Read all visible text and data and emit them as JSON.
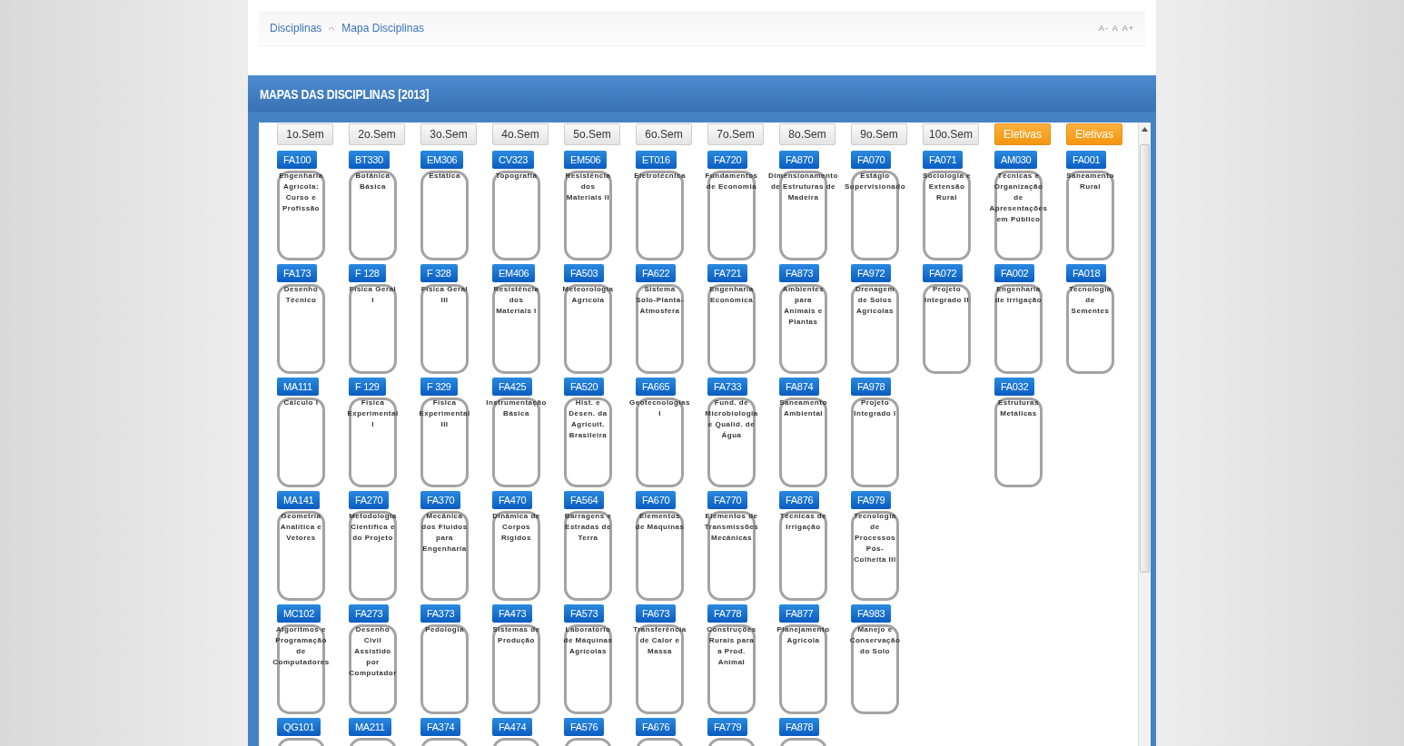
{
  "breadcrumb": [
    {
      "label": "Disciplinas"
    },
    {
      "label": "Mapa Disciplinas"
    }
  ],
  "font_controls": [
    "A-",
    "A",
    "A+"
  ],
  "panel": {
    "title": "MAPAS DAS DISCIPLINAS [2013]"
  },
  "columns": [
    {
      "header": "1o.Sem",
      "kind": "semester",
      "courses": [
        {
          "code": "FA100",
          "name": "Engenharia Agrícola: Curso e Profissão"
        },
        {
          "code": "FA173",
          "name": "Desenho Técnico"
        },
        {
          "code": "MA111",
          "name": "Cálculo I"
        },
        {
          "code": "MA141",
          "name": "Geometria Analítica e Vetores"
        },
        {
          "code": "MC102",
          "name": "Algoritmos e Programação de Computadores"
        },
        {
          "code": "QG101"
        }
      ]
    },
    {
      "header": "2o.Sem",
      "kind": "semester",
      "courses": [
        {
          "code": "BT330",
          "name": "Botânica Básica"
        },
        {
          "code": "F 128",
          "name": "Física Geral I"
        },
        {
          "code": "F 129",
          "name": "Física Experimental I"
        },
        {
          "code": "FA270",
          "name": "Metodologia Científica e do Projeto"
        },
        {
          "code": "FA273",
          "name": "Desenho Civil Assistido por Computador"
        },
        {
          "code": "MA211"
        }
      ]
    },
    {
      "header": "3o.Sem",
      "kind": "semester",
      "courses": [
        {
          "code": "EM306",
          "name": "Estática"
        },
        {
          "code": "F 328",
          "name": "Física Geral III"
        },
        {
          "code": "F 329",
          "name": "Física Experimental III"
        },
        {
          "code": "FA370",
          "name": "Mecânica dos Fluidos para Engenharia"
        },
        {
          "code": "FA373",
          "name": "Pedologia"
        },
        {
          "code": "FA374"
        }
      ]
    },
    {
      "header": "4o.Sem",
      "kind": "semester",
      "courses": [
        {
          "code": "CV323",
          "name": "Topografia"
        },
        {
          "code": "EM406",
          "name": "Resistência dos Materiais I"
        },
        {
          "code": "FA425",
          "name": "Instrumentação Básica"
        },
        {
          "code": "FA470",
          "name": "Dinâmica de Corpos Rígidos"
        },
        {
          "code": "FA473",
          "name": "Sistemas de Produção"
        },
        {
          "code": "FA474"
        }
      ]
    },
    {
      "header": "5o.Sem",
      "kind": "semester",
      "courses": [
        {
          "code": "EM506",
          "name": "Resistência dos Materiais II"
        },
        {
          "code": "FA503",
          "name": "Meteorologia Agrícola"
        },
        {
          "code": "FA520",
          "name": "Hist. e Desen. da Agricult. Brasileira"
        },
        {
          "code": "FA564",
          "name": "Barragens e Estradas de Terra"
        },
        {
          "code": "FA573",
          "name": "Laboratório de Máquinas Agrícolas"
        },
        {
          "code": "FA576"
        }
      ]
    },
    {
      "header": "6o.Sem",
      "kind": "semester",
      "courses": [
        {
          "code": "ET016",
          "name": "Eletrotécnica"
        },
        {
          "code": "FA622",
          "name": "Sistema Solo-Planta-Atmosfera"
        },
        {
          "code": "FA665",
          "name": "Geotecnologias I"
        },
        {
          "code": "FA670",
          "name": "Elementos de Máquinas"
        },
        {
          "code": "FA673",
          "name": "Transferência de Calor e Massa"
        },
        {
          "code": "FA676"
        }
      ]
    },
    {
      "header": "7o.Sem",
      "kind": "semester",
      "courses": [
        {
          "code": "FA720",
          "name": "Fundamentos de Economia"
        },
        {
          "code": "FA721",
          "name": "Engenharia Econômica"
        },
        {
          "code": "FA733",
          "name": "Fund. de Microbiologia e Qualid. de Água"
        },
        {
          "code": "FA770",
          "name": "Elementos de Transmissões Mecânicas"
        },
        {
          "code": "FA778",
          "name": "Construções Rurais para a Prod. Animal"
        },
        {
          "code": "FA779"
        }
      ]
    },
    {
      "header": "8o.Sem",
      "kind": "semester",
      "courses": [
        {
          "code": "FA870",
          "name": "Dimensionamento de Estruturas de Madeira"
        },
        {
          "code": "FA873",
          "name": "Ambientes para Animais e Plantas"
        },
        {
          "code": "FA874",
          "name": "Saneamento Ambiental"
        },
        {
          "code": "FA876",
          "name": "Técnicas de Irrigação"
        },
        {
          "code": "FA877",
          "name": "Planejamento Agrícola"
        },
        {
          "code": "FA878"
        }
      ]
    },
    {
      "header": "9o.Sem",
      "kind": "semester",
      "courses": [
        {
          "code": "FA070",
          "name": "Estágio Supervisionado"
        },
        {
          "code": "FA972",
          "name": "Drenagem de Solos Agrícolas"
        },
        {
          "code": "FA978",
          "name": "Projeto Integrado I"
        },
        {
          "code": "FA979",
          "name": "Tecnologia de Processos Pós-Colheita III"
        },
        {
          "code": "FA983",
          "name": "Manejo e Conservação do Solo"
        }
      ]
    },
    {
      "header": "10o.Sem",
      "kind": "semester",
      "courses": [
        {
          "code": "FA071",
          "name": "Sociologia e Extensão Rural"
        },
        {
          "code": "FA072",
          "name": "Projeto Integrado II"
        }
      ]
    },
    {
      "header": "Eletivas",
      "kind": "elective",
      "courses": [
        {
          "code": "AM030",
          "name": "Técnicas e Organização de Apresentações em Público"
        },
        {
          "code": "FA002",
          "name": "Engenharia de Irrigação"
        },
        {
          "code": "FA032",
          "name": "Estruturas Metálicas"
        }
      ]
    },
    {
      "header": "Eletivas",
      "kind": "elective",
      "courses": [
        {
          "code": "FA001",
          "name": "Saneamento Rural"
        },
        {
          "code": "FA018",
          "name": "Tecnologia de Sementes"
        }
      ]
    }
  ]
}
